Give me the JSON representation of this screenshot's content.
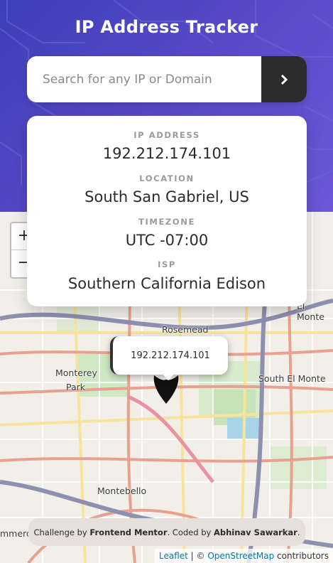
{
  "header": {
    "title": "IP Address Tracker"
  },
  "search": {
    "placeholder": "Search for any IP or Domain",
    "value": "",
    "button_icon": "chevron-right-icon"
  },
  "info": {
    "ip_label": "IP ADDRESS",
    "ip_value": "192.212.174.101",
    "location_label": "LOCATION",
    "location_value": "South San Gabriel, US",
    "timezone_label": "TIMEZONE",
    "timezone_value": "UTC -07:00",
    "isp_label": "ISP",
    "isp_value": "Southern California Edison"
  },
  "map": {
    "zoom_in": "+",
    "zoom_out": "−",
    "popup_text": "192.212.174.101",
    "marker_icon": "location-pin-icon",
    "labels": {
      "rosemead": "Rosemead",
      "monterey_park_1": "Monterey",
      "monterey_park_2": "Park",
      "south_el_monte": "South El Monte",
      "el_monte": "El Monte",
      "montebello": "Montebello",
      "commerce": "mmerce"
    }
  },
  "footer": {
    "challenge_prefix": "Challenge by ",
    "challenge_brand": "Frontend Mentor",
    "coded_prefix": ". Coded by ",
    "author": "Abhinav Sawarkar",
    "coded_suffix": "."
  },
  "attribution": {
    "leaflet": "Leaflet",
    "separator": " | © ",
    "osm": "OpenStreetMap",
    "contributors": " contributors"
  },
  "colors": {
    "header_bg": "#4b45c2",
    "button_bg": "#2b2b2b",
    "link": "#0078a8"
  }
}
